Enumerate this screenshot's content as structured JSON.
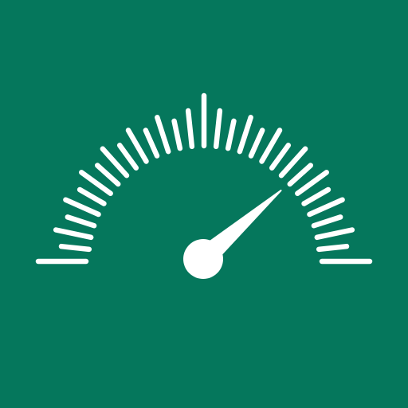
{
  "icon": {
    "name": "speedometer-icon",
    "colors": {
      "background": "#05775C",
      "foreground": "#FFFFFF"
    },
    "gauge": {
      "tick_count": 31,
      "needle_level": 0.77
    }
  }
}
